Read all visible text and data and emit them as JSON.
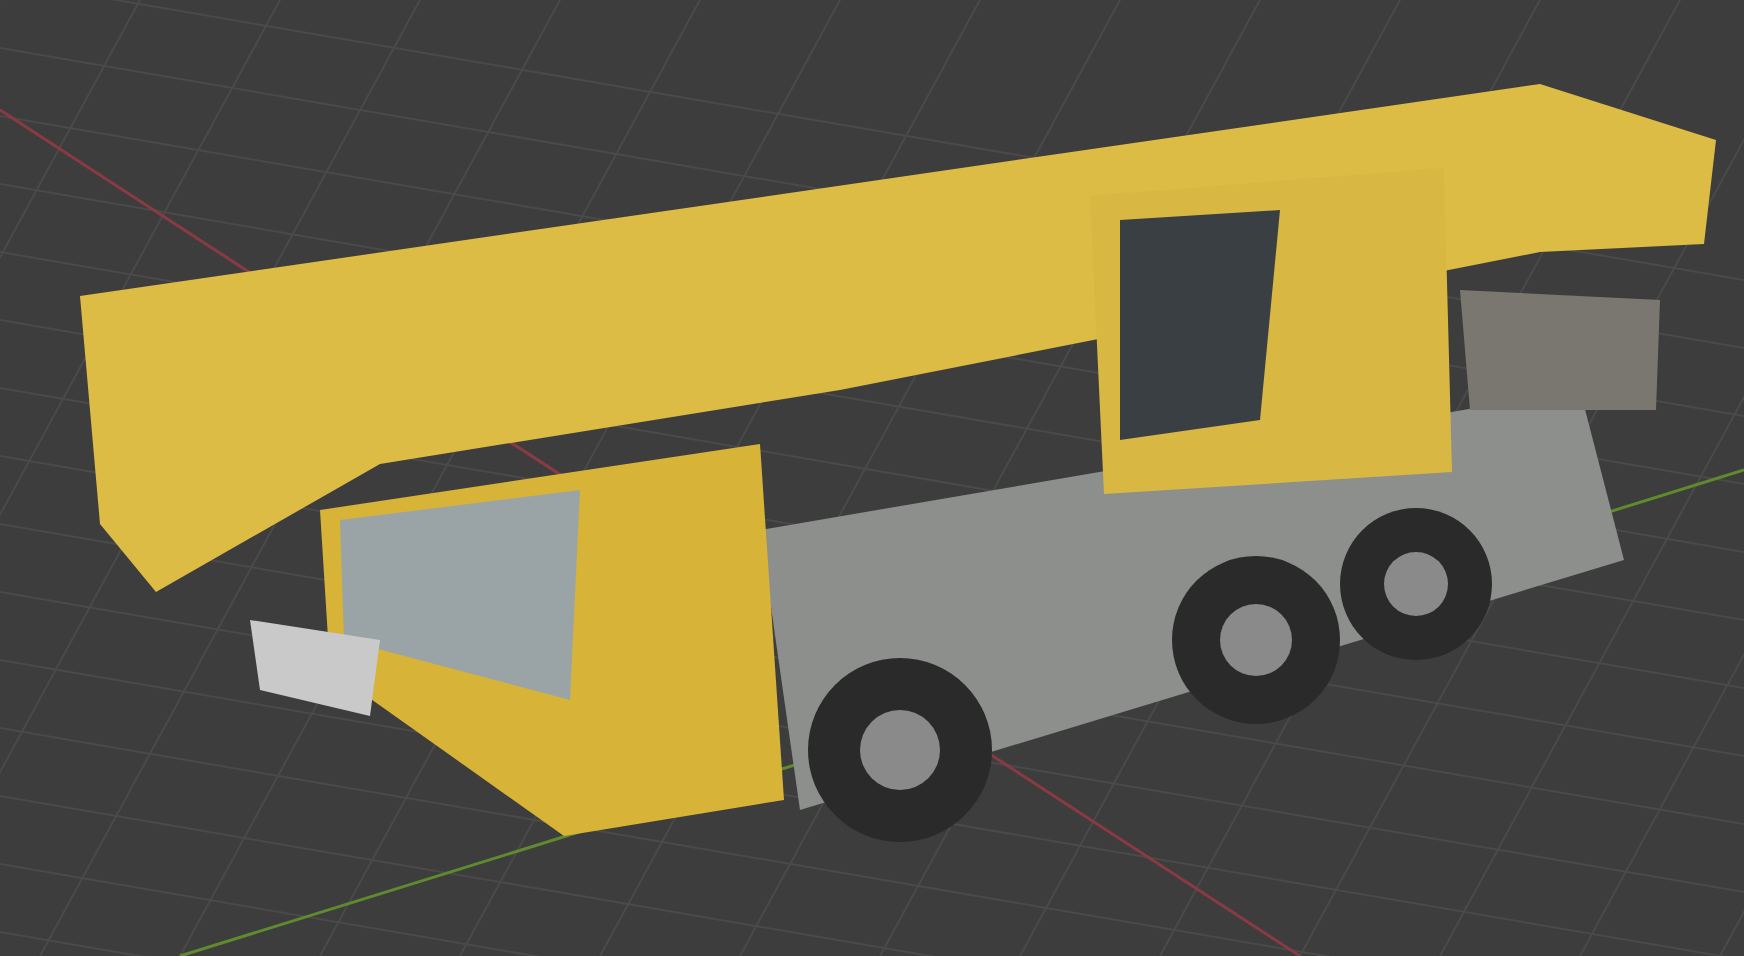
{
  "viewport": {
    "kind": "render"
  }
}
